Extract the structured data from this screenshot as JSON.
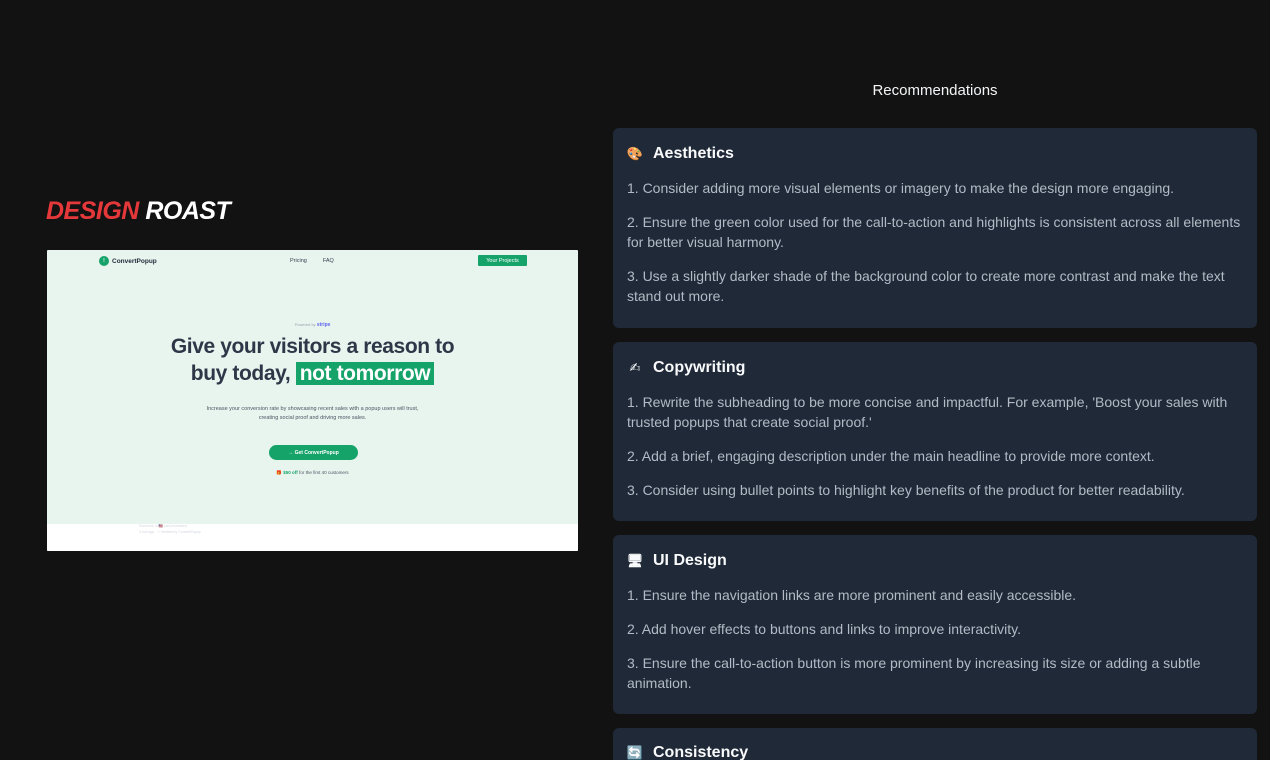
{
  "brand": {
    "part1": "DESIGN",
    "part2": "ROAST"
  },
  "preview": {
    "logo_mark": "!",
    "logo_text": "ConvertPopup",
    "nav_links": [
      "Pricing",
      "FAQ"
    ],
    "nav_button": "Your Projects",
    "powered_by": "Powered by",
    "powered_brand": "stripe",
    "headline_line1": "Give your visitors a reason to",
    "headline_line2_plain": "buy today,",
    "headline_highlight": "not tomorrow",
    "subheading": "Increase your conversion rate by showcasing recent sales with a popup users will trust, creating social proof and driving more sales.",
    "cta": "→ Get ConvertPopup",
    "offer_icon": "🎁",
    "offer_bold": "$50 off",
    "offer_rest": "for the first 40 customers",
    "popup_line1": "Someone in 🇺🇸 just purchased",
    "popup_line2": "3 min ago · ⚡ Verified by ConvertPopup"
  },
  "recommendations": {
    "title": "Recommendations",
    "sections": [
      {
        "icon": "🎨",
        "icon_name": "palette-icon",
        "heading": "Aesthetics",
        "items": [
          "1. Consider adding more visual elements or imagery to make the design more engaging.",
          "2. Ensure the green color used for the call-to-action and highlights is consistent across all elements for better visual harmony.",
          "3. Use a slightly darker shade of the background color to create more contrast and make the text stand out more."
        ]
      },
      {
        "icon": "✍",
        "icon_name": "writing-hand-icon",
        "heading": "Copywriting",
        "items": [
          "1. Rewrite the subheading to be more concise and impactful. For example, 'Boost your sales with trusted popups that create social proof.'",
          "2. Add a brief, engaging description under the main headline to provide more context.",
          "3. Consider using bullet points to highlight key benefits of the product for better readability."
        ]
      },
      {
        "icon": "🖥",
        "icon_name": "desktop-icon",
        "heading": "UI Design",
        "items": [
          "1. Ensure the navigation links are more prominent and easily accessible.",
          "2. Add hover effects to buttons and links to improve interactivity.",
          "3. Ensure the call-to-action button is more prominent by increasing its size or adding a subtle animation."
        ]
      },
      {
        "icon": "🔄",
        "icon_name": "refresh-icon",
        "heading": "Consistency",
        "items": []
      }
    ]
  }
}
